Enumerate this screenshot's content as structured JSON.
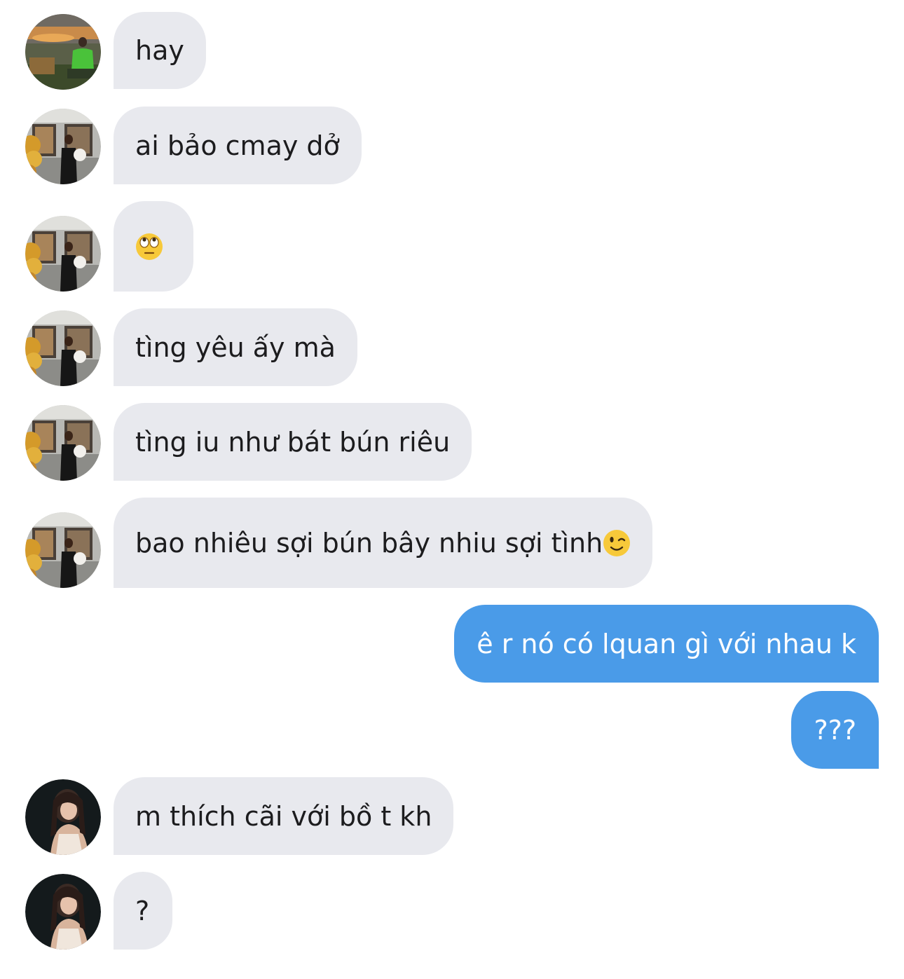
{
  "conversation": {
    "messages": [
      {
        "sender": "them",
        "avatar": "sunset-photo",
        "text": "hay"
      },
      {
        "sender": "them",
        "avatar": "storefront-photo",
        "text": "ai bảo cmay dở"
      },
      {
        "sender": "them",
        "avatar": "storefront-photo",
        "text": "",
        "emoji": "face-with-rolling-eyes"
      },
      {
        "sender": "them",
        "avatar": "storefront-photo",
        "text": "tìng yêu ấy mà"
      },
      {
        "sender": "them",
        "avatar": "storefront-photo",
        "text": "tìng iu như bát bún riêu"
      },
      {
        "sender": "them",
        "avatar": "storefront-photo",
        "text": "bao nhiêu sợi bún bây nhiu sợi tình",
        "emoji": "winking-face"
      },
      {
        "sender": "me",
        "text": "ê r nó có lquan gì với nhau k"
      },
      {
        "sender": "me",
        "text": "???"
      },
      {
        "sender": "them",
        "avatar": "dark-portrait-photo",
        "text": "m thích cãi với bồ t kh"
      },
      {
        "sender": "them",
        "avatar": "dark-portrait-photo",
        "text": "?"
      }
    ]
  },
  "colors": {
    "incoming_bubble": "#e8e9ee",
    "outgoing_bubble": "#4a9be8",
    "incoming_text": "#1c1c1e",
    "outgoing_text": "#ffffff",
    "background": "#ffffff"
  }
}
